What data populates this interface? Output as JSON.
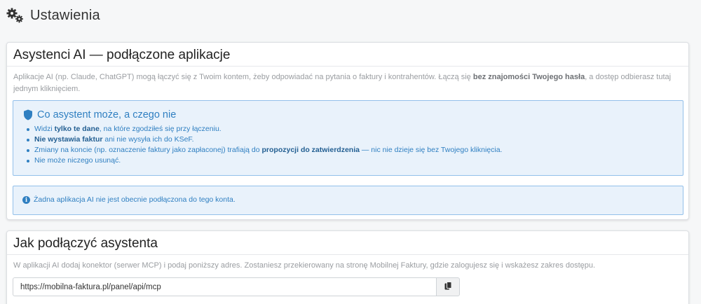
{
  "header": {
    "title": "Ustawienia",
    "icon": "gears-icon"
  },
  "connected_apps": {
    "title": "Asystenci AI — podłączone aplikacje",
    "desc_part1": "Aplikacje AI (np. Claude, ChatGPT) mogą łączyć się z Twoim kontem, żeby odpowiadać na pytania o faktury i kontrahentów. Łączą się ",
    "desc_bold": "bez znajomości Twojego hasła",
    "desc_part2": ", a dostęp odbierasz tutaj jednym kliknięciem.",
    "info_box": {
      "title": "Co asystent może, a czego nie",
      "icon": "shield-icon",
      "items": [
        {
          "pre": "Widzi ",
          "bold": "tylko te dane",
          "post": ", na które zgodziłeś się przy łączeniu."
        },
        {
          "pre": "",
          "bold": "Nie wystawia faktur",
          "post": " ani nie wysyła ich do KSeF."
        },
        {
          "pre": "Zmiany na koncie (np. oznaczenie faktury jako zapłaconej) trafiają do ",
          "bold": "propozycji do zatwierdzenia",
          "post": " — nic nie dzieje się bez Twojego kliknięcia."
        },
        {
          "pre": "Nie może niczego usunąć.",
          "bold": "",
          "post": ""
        }
      ]
    },
    "empty_message": "Żadna aplikacja AI nie jest obecnie podłączona do tego konta."
  },
  "connect": {
    "title": "Jak podłączyć asystenta",
    "desc": "W aplikacji AI dodaj konektor (serwer MCP) i podaj poniższy adres. Zostaniesz przekierowany na stronę Mobilnej Faktury, gdzie zalogujesz się i wskażesz zakres dostępu.",
    "url": "https://mobilna-faktura.pl/panel/api/mcp",
    "copy_icon": "copy-icon"
  },
  "colors": {
    "accent": "#2f7fc1",
    "info_bg": "#e9f2fb",
    "info_border": "#93c0ea"
  }
}
